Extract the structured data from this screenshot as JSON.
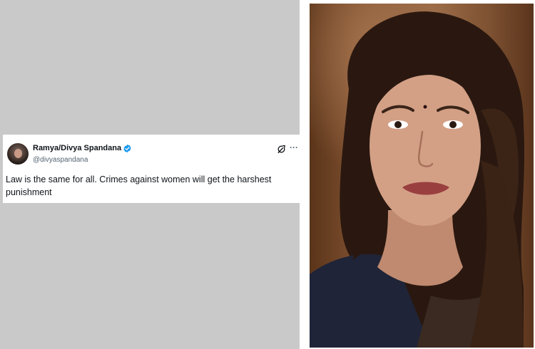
{
  "tweet": {
    "author_name": "Ramya/Divya Spandana",
    "handle": "@divyaspandana",
    "text": "Law is the same for all. Crimes against women will get the harshest punishment",
    "more_label": "···"
  },
  "colors": {
    "background_gray": "#c9c9c9",
    "card_bg": "#ffffff",
    "verified_blue": "#1d9bf0",
    "text_primary": "#0f1419",
    "text_secondary": "#536471"
  },
  "icons": [
    "avatar",
    "verified-badge-icon",
    "grok-icon",
    "more-options-icon"
  ]
}
